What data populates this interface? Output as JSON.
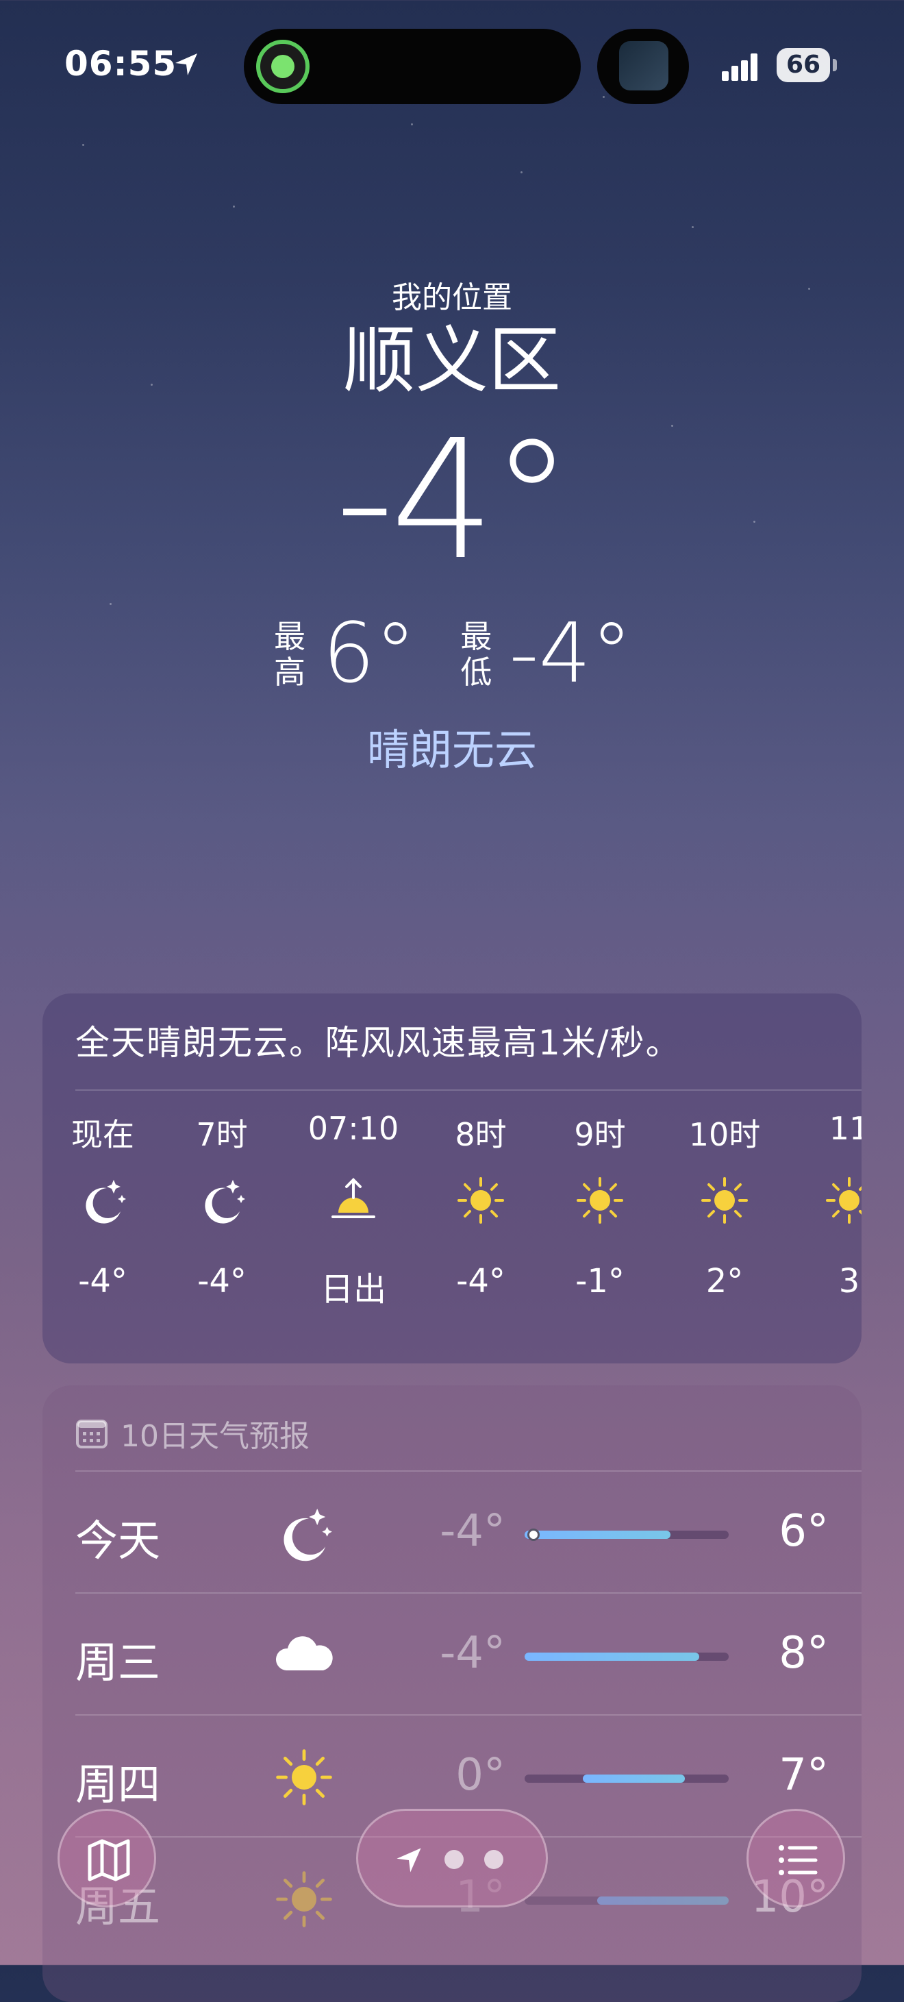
{
  "status_bar": {
    "time": "06:55",
    "battery": "66",
    "location_icon": "location-arrow-icon",
    "signal_icon": "cellular-signal-icon"
  },
  "hero": {
    "label": "我的位置",
    "city": "顺义区",
    "temperature": "-4°",
    "high_tag": "最高",
    "high": "6°",
    "low_tag": "最低",
    "low": "-4°",
    "condition": "晴朗无云"
  },
  "hourly": {
    "summary": "全天晴朗无云。阵风风速最高1米/秒。",
    "items": [
      {
        "label": "现在",
        "icon": "moon-stars-icon",
        "temp": "-4°"
      },
      {
        "label": "7时",
        "icon": "moon-stars-icon",
        "temp": "-4°"
      },
      {
        "label": "07:10",
        "icon": "sunrise-icon",
        "temp": "日出"
      },
      {
        "label": "8时",
        "icon": "sun-icon",
        "temp": "-4°"
      },
      {
        "label": "9时",
        "icon": "sun-icon",
        "temp": "-1°"
      },
      {
        "label": "10时",
        "icon": "sun-icon",
        "temp": "2°"
      },
      {
        "label": "11",
        "icon": "sun-icon",
        "temp": "3"
      }
    ]
  },
  "daily": {
    "title": "10日天气预报",
    "title_icon": "calendar-icon",
    "range_min": -4,
    "range_max": 10,
    "rows": [
      {
        "day": "今天",
        "icon": "moon-stars-icon",
        "low": "-4°",
        "high": "6°",
        "low_val": -4,
        "high_val": 6,
        "current": -4
      },
      {
        "day": "周三",
        "icon": "cloud-icon",
        "low": "-4°",
        "high": "8°",
        "low_val": -4,
        "high_val": 8
      },
      {
        "day": "周四",
        "icon": "sun-icon",
        "low": "0°",
        "high": "7°",
        "low_val": 0,
        "high_val": 7
      },
      {
        "day": "周五",
        "icon": "sun-icon",
        "low": "1°",
        "high": "10°",
        "low_val": 1,
        "high_val": 10
      }
    ]
  },
  "toolbar": {
    "map_icon": "map-icon",
    "list_icon": "list-icon",
    "page_indicator_icon": "location-arrow-icon"
  },
  "colors": {
    "condition": "#bcd2ff",
    "temp_bar": "#7ab6ff",
    "sun": "#f7d13d"
  }
}
